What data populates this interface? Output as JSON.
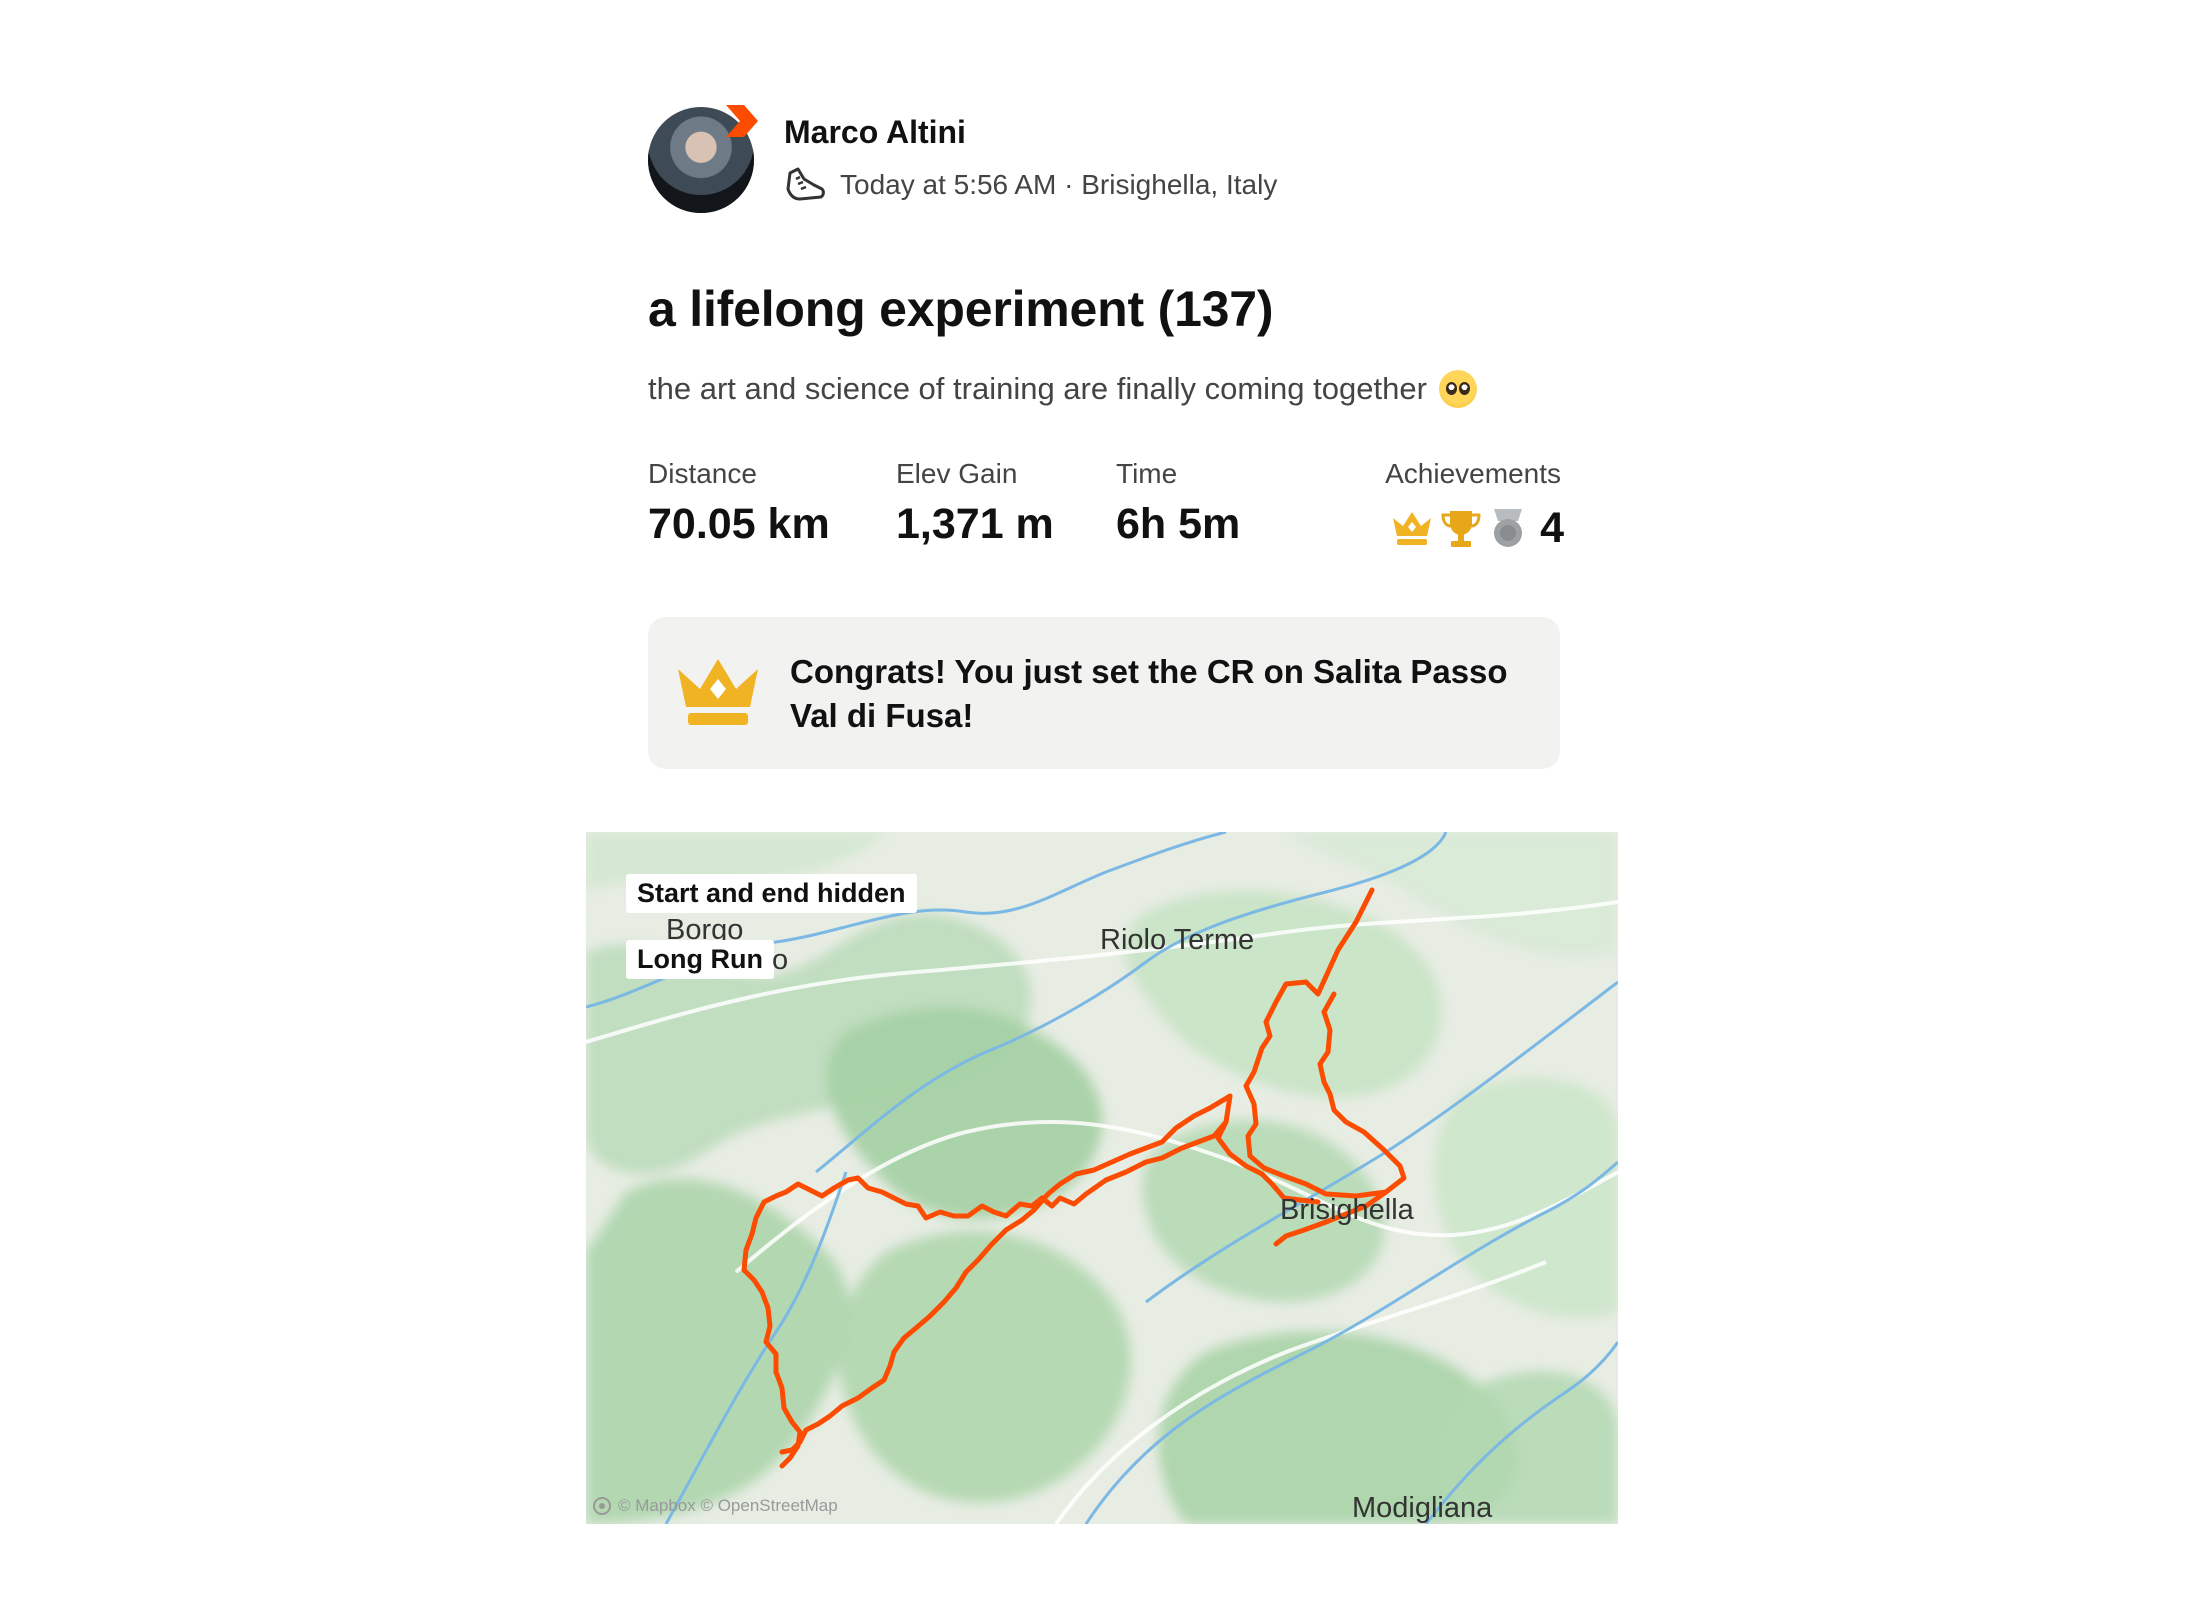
{
  "header": {
    "user_name": "Marco Altini",
    "meta": "Today at 5:56 AM · Brisighella, Italy",
    "activity_icon": "running-shoe-icon"
  },
  "activity": {
    "title": "a lifelong experiment (137)",
    "description": "the art and science of training are finally coming together"
  },
  "stats": {
    "distance": {
      "label": "Distance",
      "value": "70.05 km"
    },
    "elevation": {
      "label": "Elev Gain",
      "value": "1,371 m"
    },
    "time": {
      "label": "Time",
      "value": "6h 5m"
    },
    "achievements": {
      "label": "Achievements",
      "count": "4",
      "icons": [
        "crown-icon",
        "trophy-icon",
        "medal-icon"
      ]
    }
  },
  "congrats": {
    "line1": "Congrats! You just set the CR on Salita Passo",
    "line2": "Val di Fusa!"
  },
  "map": {
    "badges": {
      "privacy": "Start and end hidden",
      "run_type": "Long Run"
    },
    "places": {
      "borgo": "Borgo",
      "borgo_tail": "o",
      "riolo": "Riolo Terme",
      "brisighella": "Brisighella",
      "modigliana": "Modigliana"
    },
    "attribution": "© Mapbox © OpenStreetMap",
    "route_color": "#fc4c02"
  },
  "colors": {
    "accent": "#fc4c02",
    "gold": "#f0b323",
    "silver": "#9ea1a3"
  }
}
